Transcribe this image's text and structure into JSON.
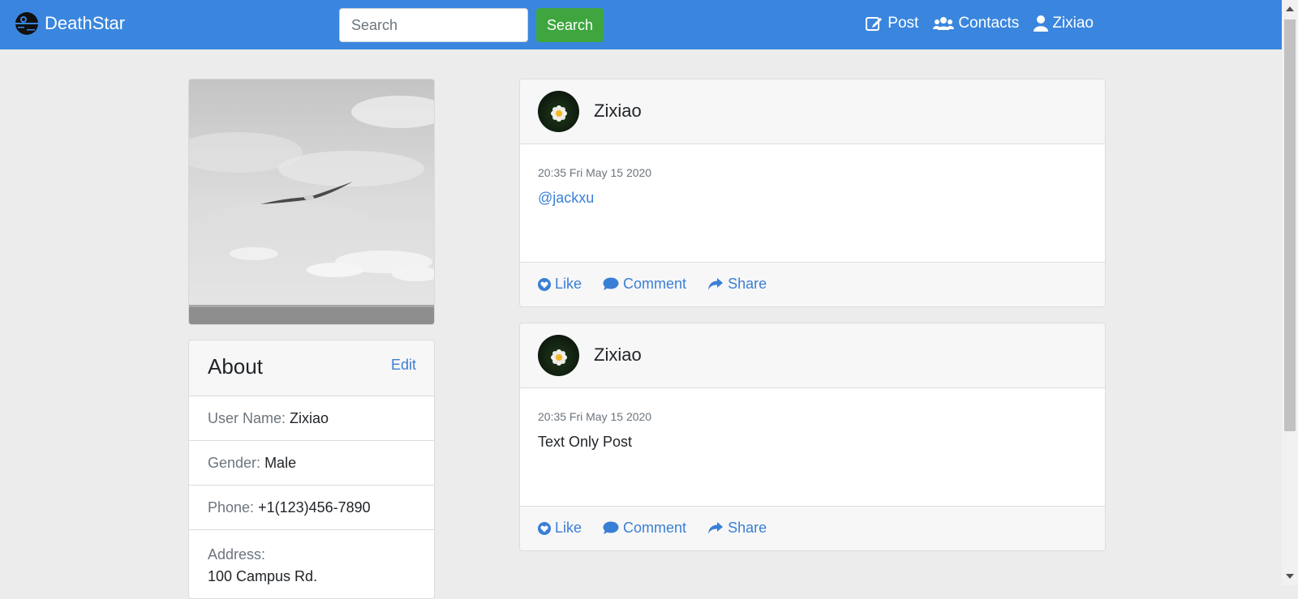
{
  "navbar": {
    "brand": "DeathStar",
    "search_placeholder": "Search",
    "search_button": "Search",
    "links": [
      {
        "label": "Post",
        "icon": "edit-icon"
      },
      {
        "label": "Contacts",
        "icon": "users-icon"
      },
      {
        "label": "Zixiao",
        "icon": "user-icon"
      }
    ]
  },
  "about": {
    "title": "About",
    "edit": "Edit",
    "username_label": "User Name:",
    "username": "Zixiao",
    "gender_label": "Gender:",
    "gender": "Male",
    "phone_label": "Phone:",
    "phone": "+1(123)456-7890",
    "address_label": "Address:",
    "address": "100 Campus Rd."
  },
  "posts": [
    {
      "author": "Zixiao",
      "time": "20:35 Fri May 15 2020",
      "content": "@jackxu",
      "actions": {
        "like": "Like",
        "comment": "Comment",
        "share": "Share"
      }
    },
    {
      "author": "Zixiao",
      "time": "20:35 Fri May 15 2020",
      "content": "Text Only Post",
      "actions": {
        "like": "Like",
        "comment": "Comment",
        "share": "Share"
      }
    }
  ],
  "colors": {
    "navbar": "#3a86de",
    "search_button": "#3fa63f",
    "link": "#3a7fd6",
    "background": "#ececec"
  }
}
